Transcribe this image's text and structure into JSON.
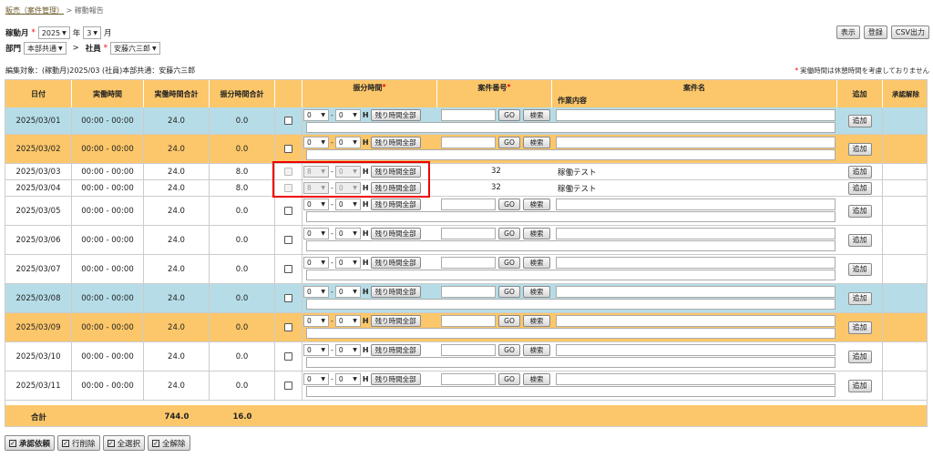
{
  "breadcrumb": {
    "parent": "販売（案件管理）",
    "sep": ">",
    "current": "稼動報告"
  },
  "filters": {
    "month_label": "稼動月",
    "required": "*",
    "year": "2025",
    "year_unit": "年",
    "month": "3",
    "month_unit": "月",
    "dept_label": "部門",
    "dept": "本部共通",
    "arrow": ">",
    "emp_label": "社員",
    "emp": "安藤六三郎"
  },
  "toolbar": {
    "show": "表示",
    "register": "登録",
    "csv": "CSV出力"
  },
  "info": "編集対象：(稼動月)2025/03 (社員)本部共通：安藤六三郎",
  "note": "実働時間は休憩時間を考慮しておりません",
  "headers": {
    "date": "日付",
    "work": "実働時間",
    "work_total": "実働時間合計",
    "alloc_total": "振分時間合計",
    "alloc": "振分時間",
    "case_no": "案件番号",
    "case_name": "案件名",
    "task": "作業内容",
    "add": "追加",
    "approve": "承認解除"
  },
  "labels": {
    "rest_all": "残り時間全部",
    "go": "GO",
    "search": "検索",
    "add": "追加",
    "h": "H",
    "dot": "-"
  },
  "rows": [
    {
      "date": "2025/03/01",
      "work": "00:00 - 00:00",
      "total": "24.0",
      "alloc": "0.0",
      "h1": "0",
      "h2": "0",
      "color": "blue"
    },
    {
      "date": "2025/03/02",
      "work": "00:00 - 00:00",
      "total": "24.0",
      "alloc": "0.0",
      "h1": "0",
      "h2": "0",
      "color": "orange"
    },
    {
      "date": "2025/03/03",
      "work": "00:00 - 00:00",
      "total": "24.0",
      "alloc": "8.0",
      "h1": "8",
      "h2": "0",
      "color": "white",
      "case_no": "32",
      "case_name": "稼働テスト",
      "locked": true
    },
    {
      "date": "2025/03/04",
      "work": "00:00 - 00:00",
      "total": "24.0",
      "alloc": "8.0",
      "h1": "8",
      "h2": "0",
      "color": "white",
      "case_no": "32",
      "case_name": "稼働テスト",
      "locked": true
    },
    {
      "date": "2025/03/05",
      "work": "00:00 - 00:00",
      "total": "24.0",
      "alloc": "0.0",
      "h1": "0",
      "h2": "0",
      "color": "white"
    },
    {
      "date": "2025/03/06",
      "work": "00:00 - 00:00",
      "total": "24.0",
      "alloc": "0.0",
      "h1": "0",
      "h2": "0",
      "color": "white"
    },
    {
      "date": "2025/03/07",
      "work": "00:00 - 00:00",
      "total": "24.0",
      "alloc": "0.0",
      "h1": "0",
      "h2": "0",
      "color": "white"
    },
    {
      "date": "2025/03/08",
      "work": "00:00 - 00:00",
      "total": "24.0",
      "alloc": "0.0",
      "h1": "0",
      "h2": "0",
      "color": "blue"
    },
    {
      "date": "2025/03/09",
      "work": "00:00 - 00:00",
      "total": "24.0",
      "alloc": "0.0",
      "h1": "0",
      "h2": "0",
      "color": "orange"
    },
    {
      "date": "2025/03/10",
      "work": "00:00 - 00:00",
      "total": "24.0",
      "alloc": "0.0",
      "h1": "0",
      "h2": "0",
      "color": "white"
    },
    {
      "date": "2025/03/11",
      "work": "00:00 - 00:00",
      "total": "24.0",
      "alloc": "0.0",
      "h1": "0",
      "h2": "0",
      "color": "white"
    }
  ],
  "footer": {
    "label": "合計",
    "work_total": "744.0",
    "alloc_total": "16.0"
  },
  "actions": {
    "approve": "承認依頼",
    "delete": "行削除",
    "select_all": "全選択",
    "clear_all": "全解除"
  }
}
